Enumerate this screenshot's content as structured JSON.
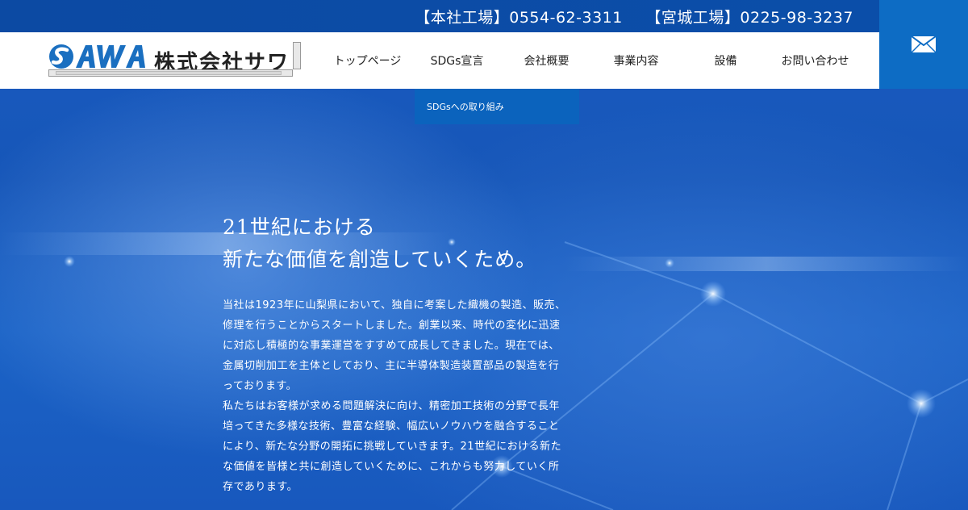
{
  "topbar": {
    "phone_main": "【本社工場】0554-62-3311",
    "phone_miyagi": "【宮城工場】0225-98-3237"
  },
  "header": {
    "logo_mark": "SAWA",
    "company_name": "株式会社サワ"
  },
  "nav": {
    "items": [
      {
        "label": "トップページ"
      },
      {
        "label": "SDGs宣言"
      },
      {
        "label": "会社概要"
      },
      {
        "label": "事業内容"
      },
      {
        "label": "設備"
      },
      {
        "label": "お問い合わせ"
      }
    ],
    "dropdown_label": "SDGsへの取り組み"
  },
  "hero": {
    "headline_line1": "21世紀における",
    "headline_line2": "新たな価値を創造していくため。",
    "paragraph1": "当社は1923年に山梨県において、独自に考案した織機の製造、販売、修理を行うことからスタートしました。創業以来、時代の変化に迅速に対応し積極的な事業運営をすすめて成長してきました。現在では、金属切削加工を主体としており、主に半導体製造装置部品の製造を行っております。",
    "paragraph2": "私たちはお客様が求める問題解決に向け、精密加工技術の分野で長年培ってきた多様な技術、豊富な経験、幅広いノウハウを融合することにより、新たな分野の開拓に挑戦していきます。21世紀における新たな価値を皆様と共に創造していくために、これからも努力していく所存であります。"
  },
  "colors": {
    "topbar": "#0c4aa3",
    "mail_box": "#0d6cc4",
    "dropdown": "#0b63bd",
    "logo_blue": "#1a6fc0"
  },
  "icons": {
    "mail": "mail-icon"
  }
}
